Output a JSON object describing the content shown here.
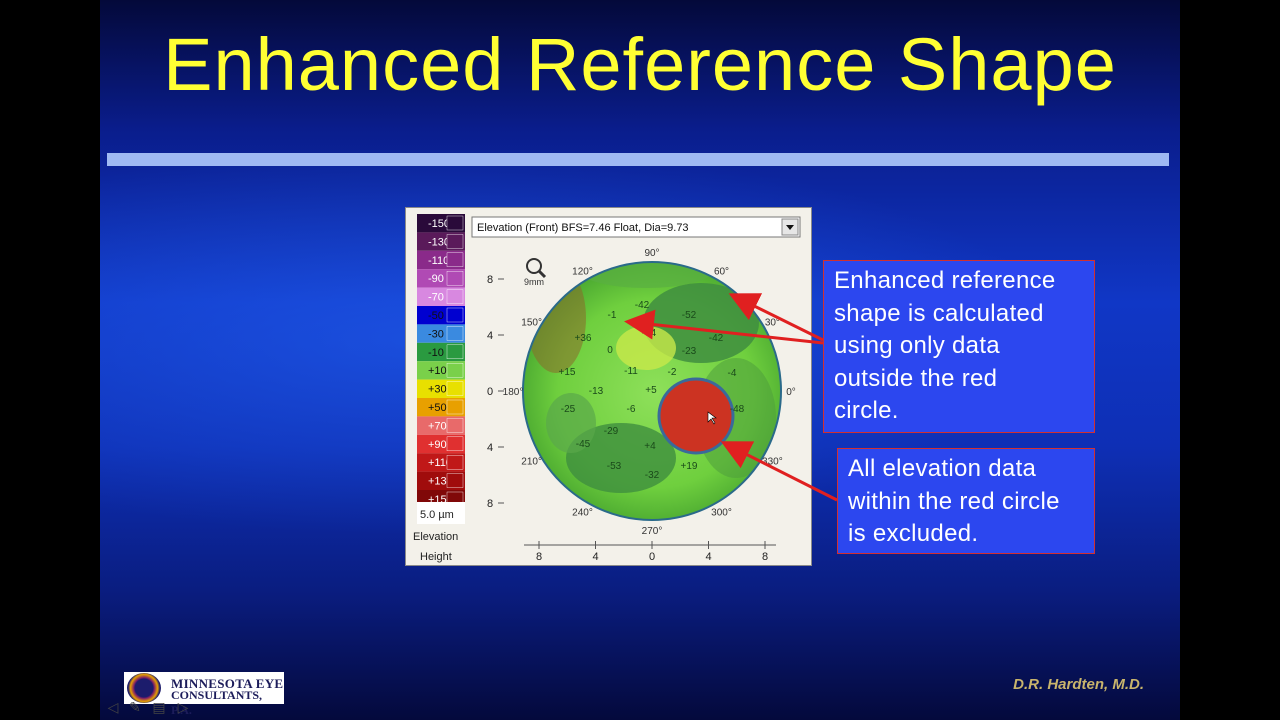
{
  "slide": {
    "title": "Enhanced Reference Shape",
    "author": "D.R. Hardten, M.D.",
    "logo": {
      "line1": "MINNESOTA EYE",
      "line2": "CONSULTANTS, P.A."
    },
    "colors": {
      "title": "#ffff33",
      "rule": "#9fb9f3",
      "callout_bg": "#2c47ef",
      "arrow": "#e02020"
    }
  },
  "topography": {
    "dropdown_label": "Elevation (Front)  BFS=7.46 Float, Dia=9.73",
    "zoom_label": "9mm",
    "scale_values": [
      "-150",
      "-130",
      "-110",
      "-90",
      "-70",
      "-50",
      "-30",
      "-10",
      "+10",
      "+30",
      "+50",
      "+70",
      "+90",
      "+110",
      "+130",
      "+150"
    ],
    "scale_colors": [
      "#2a0a3a",
      "#5a1a5a",
      "#8a2a8a",
      "#b04ab4",
      "#d888e0",
      "#0000d0",
      "#3a8ae0",
      "#2a9a40",
      "#7ad04a",
      "#e8e000",
      "#e8a000",
      "#e86a6a",
      "#e03030",
      "#c01818",
      "#a00c0c",
      "#800808"
    ],
    "step_label": "5.0 µm",
    "mode_label": "Elevation",
    "height_label": "Height",
    "y_ticks": [
      "8",
      "4",
      "0",
      "4",
      "8"
    ],
    "x_ticks": [
      "8",
      "4",
      "0",
      "4",
      "8"
    ],
    "angle_labels": [
      "90°",
      "60°",
      "30°",
      "0°",
      "330°",
      "300°",
      "270°",
      "240°",
      "210°",
      "180°",
      "150°",
      "120°"
    ],
    "values": [
      "-42",
      "-52",
      "-1",
      "+36",
      "-34",
      "-42",
      "0",
      "-23",
      "+15",
      "-11",
      "-2",
      "-4",
      "-13",
      "+5",
      "-6",
      "-25",
      "-29",
      "+4",
      "-45",
      "-53",
      "-32",
      "+19",
      "-48"
    ]
  },
  "callouts": {
    "first": [
      "Enhanced reference",
      "shape is calculated",
      "using only data",
      "outside the red",
      "circle."
    ],
    "second": [
      "All elevation data",
      "within the red circle",
      "is excluded."
    ]
  },
  "nav": {
    "prev_icon": "arrow-left-icon",
    "pen_icon": "pen-icon",
    "menu_icon": "menu-icon",
    "next_icon": "arrow-right-icon"
  }
}
